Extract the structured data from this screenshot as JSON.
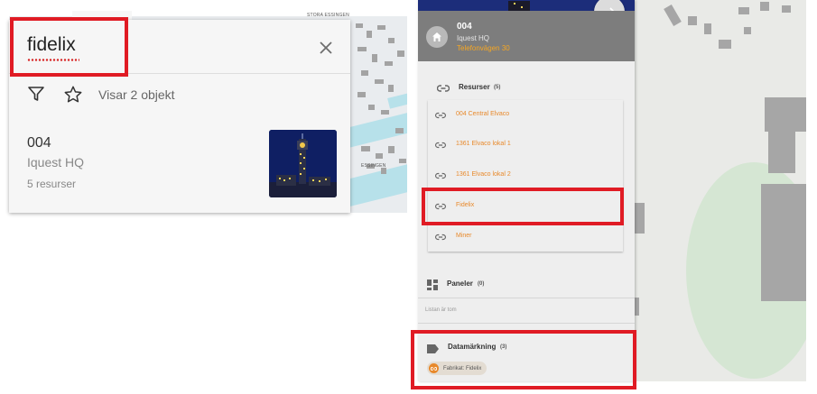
{
  "search": {
    "value": "fidelix",
    "results_count": "Visar 2 objekt"
  },
  "result": {
    "title": "004",
    "subtitle": "Iquest HQ",
    "resources": "5 resurser"
  },
  "map": {
    "label_top": "STORA ESSINGEN",
    "label_mid": "ESSINGEN"
  },
  "site": {
    "code": "004",
    "name": "Iquest HQ",
    "address": "Telefonvägen 30"
  },
  "resources": {
    "title": "Resurser",
    "count": "(5)",
    "items": [
      {
        "label": "004 Central Elvaco"
      },
      {
        "label": "1361 Elvaco lokal 1"
      },
      {
        "label": "1361 Elvaco lokal 2"
      },
      {
        "label": "Fidelix"
      },
      {
        "label": "Miner"
      }
    ]
  },
  "panels": {
    "title": "Paneler",
    "count": "(0)",
    "empty": "Listan är tom"
  },
  "tags": {
    "title": "Datamärkning",
    "count": "(3)",
    "chip": "Fabrikat: Fidelix"
  },
  "colors": {
    "accent": "#e8892b",
    "highlight": "#e01b24",
    "header_gray": "#7d7d7d"
  }
}
